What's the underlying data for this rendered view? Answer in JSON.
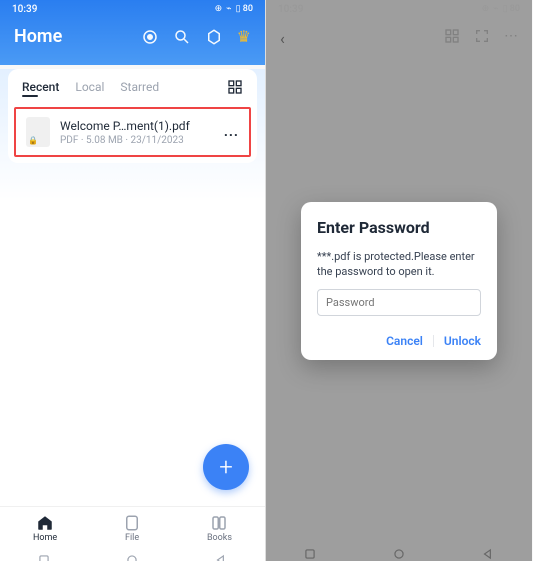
{
  "status": {
    "time": "10:39",
    "signal": "⁴ᴳ▫▮",
    "battery_pct": "80"
  },
  "left": {
    "title": "Home",
    "tabs": {
      "recent": "Recent",
      "local": "Local",
      "starred": "Starred"
    },
    "file": {
      "name": "Welcome P…ment(1).pdf",
      "meta": "PDF · 5.08 MB · 23/11/2023",
      "more": "..."
    },
    "fab": "+",
    "nav": {
      "home": "Home",
      "file": "File",
      "books": "Books"
    }
  },
  "right": {
    "dialog": {
      "title": "Enter Password",
      "message": "***.pdf is protected.Please enter the password to open it.",
      "placeholder": "Password",
      "cancel": "Cancel",
      "unlock": "Unlock"
    }
  }
}
